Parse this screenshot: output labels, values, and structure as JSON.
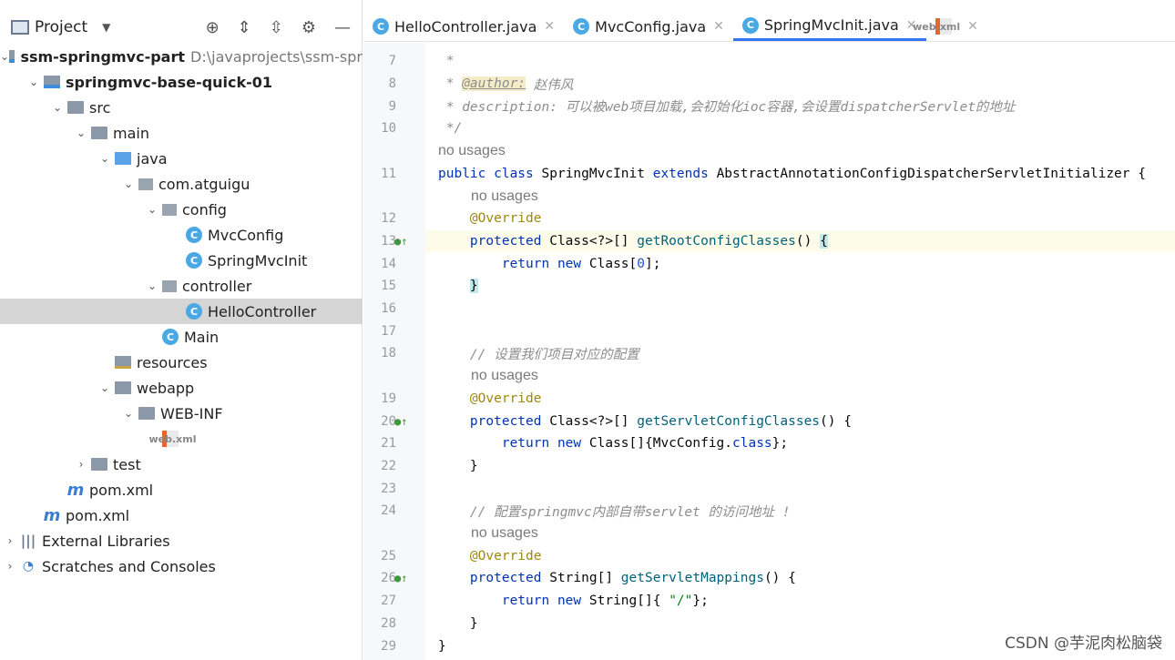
{
  "project_panel": {
    "title": "Project",
    "toolbar_icons": [
      "crosshair-icon",
      "expand-all-icon",
      "collapse-all-icon",
      "gear-icon",
      "minimize-icon"
    ],
    "tree": [
      {
        "label": "ssm-springmvc-part",
        "extra": "D:\\javaprojects\\ssm-spr",
        "level": 0,
        "arrow": "v",
        "icon": "module",
        "bold": true
      },
      {
        "label": "springmvc-base-quick-01",
        "level": 1,
        "arrow": "v",
        "icon": "module",
        "bold": true
      },
      {
        "label": "src",
        "level": 2,
        "arrow": "v",
        "icon": "folder"
      },
      {
        "label": "main",
        "level": 3,
        "arrow": "v",
        "icon": "folder"
      },
      {
        "label": "java",
        "level": 4,
        "arrow": "v",
        "icon": "java"
      },
      {
        "label": "com.atguigu",
        "level": 5,
        "arrow": "v",
        "icon": "pkg"
      },
      {
        "label": "config",
        "level": 6,
        "arrow": "v",
        "icon": "pkg"
      },
      {
        "label": "MvcConfig",
        "level": 7,
        "icon": "cls"
      },
      {
        "label": "SpringMvcInit",
        "level": 7,
        "icon": "cls"
      },
      {
        "label": "controller",
        "level": 6,
        "arrow": "v",
        "icon": "pkg"
      },
      {
        "label": "HelloController",
        "level": 7,
        "icon": "cls",
        "selected": true
      },
      {
        "label": "Main",
        "level": 6,
        "icon": "main"
      },
      {
        "label": "resources",
        "level": 4,
        "icon": "res"
      },
      {
        "label": "webapp",
        "level": 4,
        "arrow": "v",
        "icon": "web"
      },
      {
        "label": "WEB-INF",
        "level": 5,
        "arrow": "v",
        "icon": "folder"
      },
      {
        "label": "web.xml",
        "level": 6,
        "icon": "xml"
      },
      {
        "label": "test",
        "level": 3,
        "arrow": ">",
        "icon": "folder"
      },
      {
        "label": "pom.xml",
        "level": 2,
        "icon": "mvn"
      },
      {
        "label": "pom.xml",
        "level": 1,
        "icon": "mvn"
      },
      {
        "label": "External Libraries",
        "level": 0,
        "arrow": ">",
        "icon": "lib"
      },
      {
        "label": "Scratches and Consoles",
        "level": 0,
        "arrow": ">",
        "icon": "scr"
      }
    ]
  },
  "tabs": [
    {
      "label": "HelloController.java",
      "icon": "cls"
    },
    {
      "label": "MvcConfig.java",
      "icon": "cls"
    },
    {
      "label": "SpringMvcInit.java",
      "icon": "cls",
      "active": true
    },
    {
      "label": "web.xml",
      "icon": "xml"
    }
  ],
  "code": [
    {
      "n": "7",
      "t": [
        [
          " *",
          "cm"
        ]
      ]
    },
    {
      "n": "8",
      "t": [
        [
          " * ",
          "cm"
        ],
        [
          "@author:",
          "tag"
        ],
        [
          " 赵伟风",
          "cm"
        ]
      ]
    },
    {
      "n": "9",
      "t": [
        [
          " * description: 可以被web项目加载,会初始化ioc容器,会设置dispatcherServlet的地址",
          "cm"
        ]
      ]
    },
    {
      "n": "10",
      "t": [
        [
          " */",
          "cm"
        ]
      ]
    },
    {
      "hint": "no usages",
      "indent": 0
    },
    {
      "n": "11",
      "t": [
        [
          "public class ",
          "kw"
        ],
        [
          "SpringMvcInit ",
          "pl"
        ],
        [
          "extends ",
          "kw"
        ],
        [
          "AbstractAnnotationConfigDispatcherServletInitializer {",
          "pl"
        ]
      ]
    },
    {
      "hint": "no usages",
      "indent": 1
    },
    {
      "n": "12",
      "t": [
        [
          "    @Override",
          "an"
        ]
      ]
    },
    {
      "n": "13",
      "cur": true,
      "mark": true,
      "t": [
        [
          "    protected ",
          "kw"
        ],
        [
          "Class<?>[] ",
          "pl"
        ],
        [
          "getRootConfigClasses",
          "fn"
        ],
        [
          "() ",
          "pl"
        ],
        [
          "{",
          "br"
        ]
      ]
    },
    {
      "n": "14",
      "t": [
        [
          "        return new ",
          "kw"
        ],
        [
          "Class[",
          "pl"
        ],
        [
          "0",
          "num"
        ],
        [
          "];",
          "pl"
        ]
      ]
    },
    {
      "n": "15",
      "t": [
        [
          "    ",
          "pl"
        ],
        [
          "}",
          "br"
        ]
      ]
    },
    {
      "n": "16",
      "t": []
    },
    {
      "n": "17",
      "t": []
    },
    {
      "n": "18",
      "t": [
        [
          "    // 设置我们项目对应的配置",
          "cm"
        ]
      ]
    },
    {
      "hint": "no usages",
      "indent": 1
    },
    {
      "n": "19",
      "t": [
        [
          "    @Override",
          "an"
        ]
      ]
    },
    {
      "n": "20",
      "mark": true,
      "t": [
        [
          "    protected ",
          "kw"
        ],
        [
          "Class<?>[] ",
          "pl"
        ],
        [
          "getServletConfigClasses",
          "fn"
        ],
        [
          "() {",
          "pl"
        ]
      ]
    },
    {
      "n": "21",
      "t": [
        [
          "        return new ",
          "kw"
        ],
        [
          "Class[]{MvcConfig.",
          "pl"
        ],
        [
          "class",
          "kw"
        ],
        [
          "};",
          "pl"
        ]
      ]
    },
    {
      "n": "22",
      "t": [
        [
          "    }",
          "pl"
        ]
      ]
    },
    {
      "n": "23",
      "t": []
    },
    {
      "n": "24",
      "t": [
        [
          "    // 配置springmvc内部自带servlet 的访问地址 !",
          "cm"
        ]
      ]
    },
    {
      "hint": "no usages",
      "indent": 1
    },
    {
      "n": "25",
      "t": [
        [
          "    @Override",
          "an"
        ]
      ]
    },
    {
      "n": "26",
      "mark": true,
      "t": [
        [
          "    protected ",
          "kw"
        ],
        [
          "String[] ",
          "pl"
        ],
        [
          "getServletMappings",
          "fn"
        ],
        [
          "() {",
          "pl"
        ]
      ]
    },
    {
      "n": "27",
      "t": [
        [
          "        return new ",
          "kw"
        ],
        [
          "String[]{ ",
          "pl"
        ],
        [
          "\"/\"",
          "str"
        ],
        [
          "};",
          "pl"
        ]
      ]
    },
    {
      "n": "28",
      "t": [
        [
          "    }",
          "pl"
        ]
      ]
    },
    {
      "n": "29",
      "t": [
        [
          "}",
          "pl"
        ]
      ]
    }
  ],
  "watermark": "CSDN @芋泥肉松脑袋"
}
